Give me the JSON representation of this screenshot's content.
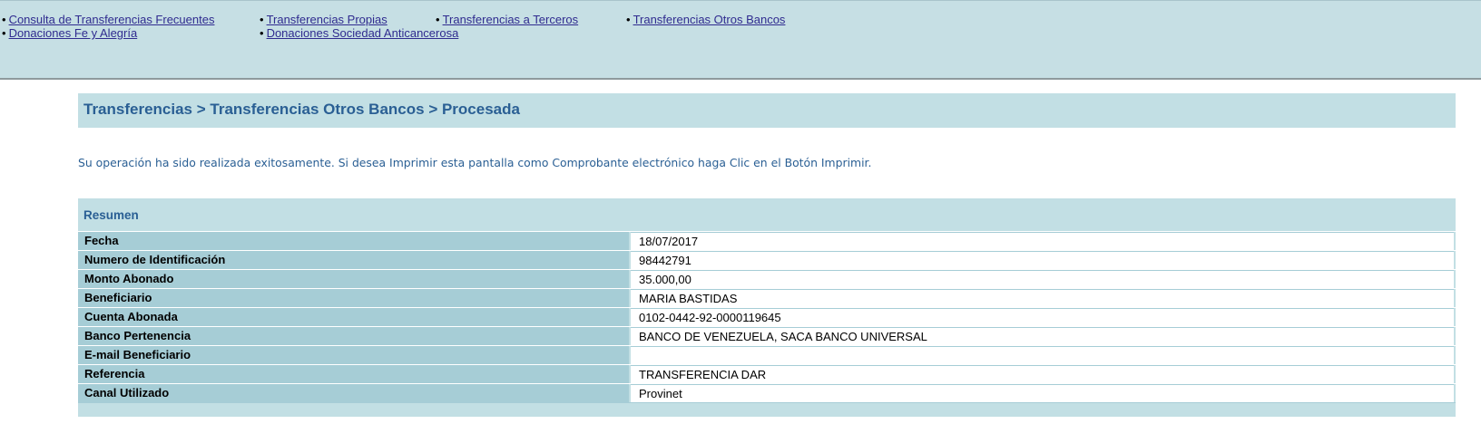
{
  "nav": {
    "links": [
      "Consulta de Transferencias Frecuentes",
      "Transferencias Propias",
      "Transferencias a Terceros",
      "Transferencias Otros Bancos",
      "Donaciones Fe y Alegría",
      "Donaciones Sociedad Anticancerosa"
    ],
    "bullet": "•"
  },
  "page": {
    "breadcrumb": "Transferencias > Transferencias Otros Bancos > Procesada",
    "message": "Su operación ha sido realizada exitosamente. Si desea Imprimir esta pantalla como Comprobante electrónico haga Clic en el Botón Imprimir."
  },
  "summary": {
    "title": "Resumen",
    "rows": [
      {
        "label": "Fecha",
        "value": "18/07/2017"
      },
      {
        "label": "Numero de Identificación",
        "value": "98442791"
      },
      {
        "label": "Monto Abonado",
        "value": "35.000,00"
      },
      {
        "label": "Beneficiario",
        "value": "MARIA BASTIDAS"
      },
      {
        "label": "Cuenta Abonada",
        "value": "0102-0442-92-0000119645"
      },
      {
        "label": "Banco Pertenencia",
        "value": "BANCO DE VENEZUELA, SACA BANCO UNIVERSAL"
      },
      {
        "label": "E-mail Beneficiario",
        "value": ""
      },
      {
        "label": "Referencia",
        "value": "TRANSFERENCIA DAR"
      },
      {
        "label": "Canal Utilizado",
        "value": "Provinet"
      }
    ]
  },
  "colors": {
    "nav_bg": "#c6dfe4",
    "header_bg": "#c2dfe4",
    "label_bg": "#a6cdd6",
    "accent_text": "#2a5f94",
    "link": "#2f2b8f"
  }
}
